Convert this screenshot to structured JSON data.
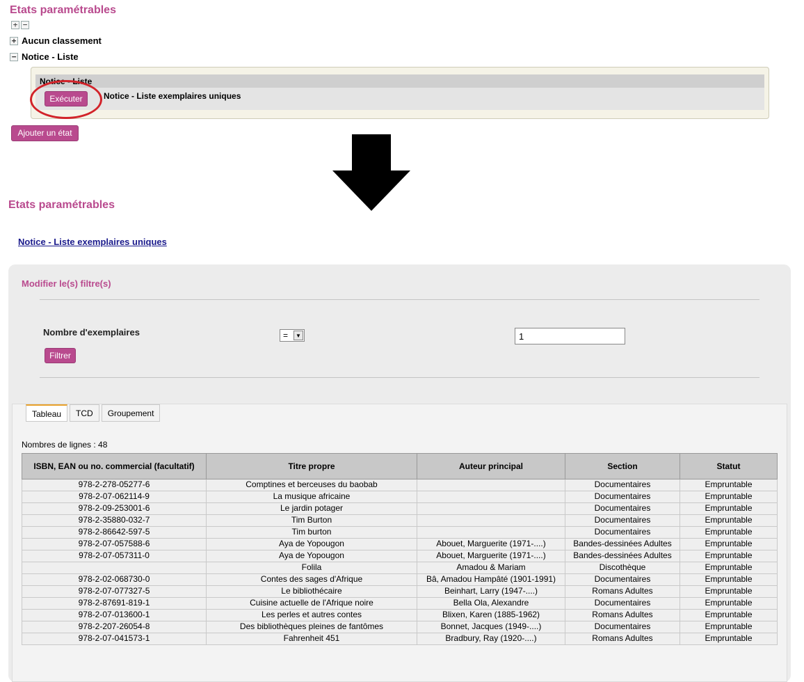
{
  "top": {
    "title": "Etats paramétrables",
    "expand_all": "+",
    "collapse_all": "−",
    "tree": [
      {
        "toggle": "+",
        "label": "Aucun classement"
      },
      {
        "toggle": "−",
        "label": "Notice - Liste"
      }
    ],
    "panel_header": "Notice - Liste",
    "execute_button": "Exécuter",
    "report_name": "Notice - Liste exemplaires uniques",
    "add_state_button": "Ajouter un état"
  },
  "bottom": {
    "title": "Etats paramétrables",
    "report_link": "Notice - Liste exemplaires uniques",
    "filter": {
      "title": "Modifier le(s) filtre(s)",
      "label": "Nombre d'exemplaires",
      "operator": "=",
      "value": "1",
      "filter_button": "Filtrer"
    },
    "tabs": [
      "Tableau",
      "TCD",
      "Groupement"
    ],
    "line_count": "Nombres de lignes : 48",
    "columns": [
      "ISBN, EAN ou no. commercial (facultatif)",
      "Titre propre",
      "Auteur principal",
      "Section",
      "Statut"
    ],
    "rows": [
      [
        "978-2-278-05277-6",
        "Comptines et berceuses du baobab",
        "",
        "Documentaires",
        "Empruntable"
      ],
      [
        "978-2-07-062114-9",
        "La musique africaine",
        "",
        "Documentaires",
        "Empruntable"
      ],
      [
        "978-2-09-253001-6",
        "Le jardin potager",
        "",
        "Documentaires",
        "Empruntable"
      ],
      [
        "978-2-35880-032-7",
        "Tim Burton",
        "",
        "Documentaires",
        "Empruntable"
      ],
      [
        "978-2-86642-597-5",
        "Tim burton",
        "",
        "Documentaires",
        "Empruntable"
      ],
      [
        "978-2-07-057588-6",
        "Aya de Yopougon",
        "Abouet, Marguerite (1971-....)",
        "Bandes-dessinées Adultes",
        "Empruntable"
      ],
      [
        "978-2-07-057311-0",
        "Aya de Yopougon",
        "Abouet, Marguerite (1971-....)",
        "Bandes-dessinées Adultes",
        "Empruntable"
      ],
      [
        "",
        "Folila",
        "Amadou & Mariam",
        "Discothèque",
        "Empruntable"
      ],
      [
        "978-2-02-068730-0",
        "Contes des sages d'Afrique",
        "Bâ, Amadou Hampâté (1901-1991)",
        "Documentaires",
        "Empruntable"
      ],
      [
        "978-2-07-077327-5",
        "Le bibliothécaire",
        "Beinhart, Larry (1947-....)",
        "Romans Adultes",
        "Empruntable"
      ],
      [
        "978-2-87691-819-1",
        "Cuisine actuelle de l'Afrique noire",
        "Bella Ola, Alexandre",
        "Documentaires",
        "Empruntable"
      ],
      [
        "978-2-07-013600-1",
        "Les perles et autres contes",
        "Blixen, Karen (1885-1962)",
        "Romans Adultes",
        "Empruntable"
      ],
      [
        "978-2-207-26054-8",
        "Des bibliothèques pleines de fantômes",
        "Bonnet, Jacques (1949-....)",
        "Documentaires",
        "Empruntable"
      ],
      [
        "978-2-07-041573-1",
        "Fahrenheit 451",
        "Bradbury, Ray (1920-....)",
        "Romans Adultes",
        "Empruntable"
      ]
    ]
  },
  "colors": {
    "brand": "#b94a8e",
    "annotation": "#d2232a"
  }
}
